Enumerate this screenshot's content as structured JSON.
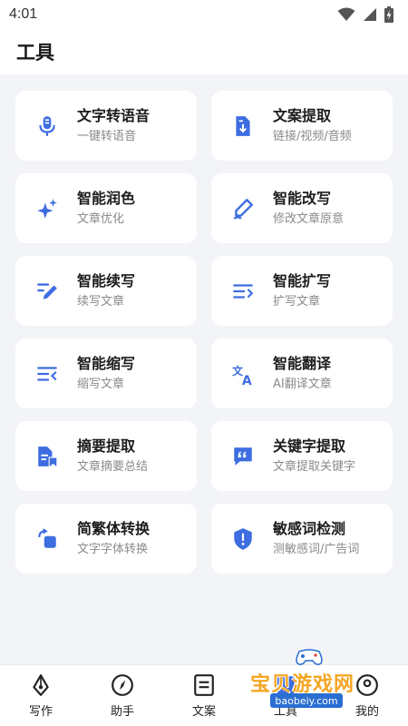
{
  "status": {
    "time": "4:01"
  },
  "header": {
    "title": "工具"
  },
  "tools": [
    {
      "title": "文字转语音",
      "desc": "一键转语音",
      "icon": "microphone-icon"
    },
    {
      "title": "文案提取",
      "desc": "链接/视频/音频",
      "icon": "document-download-icon"
    },
    {
      "title": "智能润色",
      "desc": "文章优化",
      "icon": "sparkle-icon"
    },
    {
      "title": "智能改写",
      "desc": "修改文章原意",
      "icon": "pen-scribble-icon"
    },
    {
      "title": "智能续写",
      "desc": "续写文章",
      "icon": "pencil-lines-icon"
    },
    {
      "title": "智能扩写",
      "desc": "扩写文章",
      "icon": "list-expand-icon"
    },
    {
      "title": "智能缩写",
      "desc": "缩写文章",
      "icon": "list-collapse-icon"
    },
    {
      "title": "智能翻译",
      "desc": "AI翻译文章",
      "icon": "translate-icon"
    },
    {
      "title": "摘要提取",
      "desc": "文章摘要总结",
      "icon": "document-bookmark-icon"
    },
    {
      "title": "关键字提取",
      "desc": "文章提取关键字",
      "icon": "quote-bubble-icon"
    },
    {
      "title": "简繁体转换",
      "desc": "文字字体转换",
      "icon": "convert-icon"
    },
    {
      "title": "敏感词检测",
      "desc": "测敏感词/广告词",
      "icon": "shield-alert-icon"
    }
  ],
  "nav": [
    {
      "label": "写作",
      "icon": "pen-nib-icon"
    },
    {
      "label": "助手",
      "icon": "compass-icon"
    },
    {
      "label": "文案",
      "icon": "document-lines-icon"
    },
    {
      "label": "工具",
      "icon": "toolbox-icon"
    },
    {
      "label": "我的",
      "icon": "user-icon"
    }
  ],
  "watermark": {
    "text": "宝贝游戏网",
    "url": "baobeiy.com"
  },
  "colors": {
    "accent": "#3d6de0",
    "background": "#f3f4f7"
  }
}
